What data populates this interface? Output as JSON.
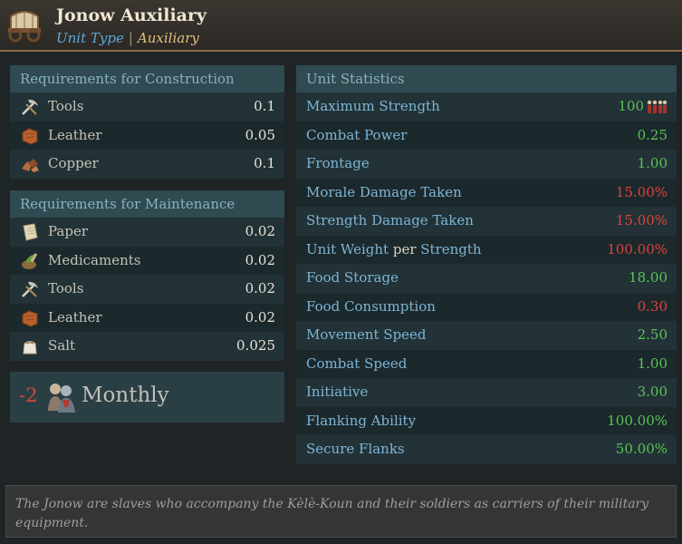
{
  "header": {
    "title": "Jonow Auxiliary",
    "type_key": "Unit Type",
    "separator": "|",
    "type_value": "Auxiliary"
  },
  "construction": {
    "heading": "Requirements for Construction",
    "items": [
      {
        "icon": "tools-icon",
        "label": "Tools",
        "value": "0.1"
      },
      {
        "icon": "leather-icon",
        "label": "Leather",
        "value": "0.05"
      },
      {
        "icon": "copper-icon",
        "label": "Copper",
        "value": "0.1"
      }
    ]
  },
  "maintenance": {
    "heading": "Requirements for Maintenance",
    "items": [
      {
        "icon": "paper-icon",
        "label": "Paper",
        "value": "0.02"
      },
      {
        "icon": "medicaments-icon",
        "label": "Medicaments",
        "value": "0.02"
      },
      {
        "icon": "tools-icon",
        "label": "Tools",
        "value": "0.02"
      },
      {
        "icon": "leather-icon",
        "label": "Leather",
        "value": "0.02"
      },
      {
        "icon": "salt-icon",
        "label": "Salt",
        "value": "0.025"
      }
    ]
  },
  "monthly": {
    "value": "-2",
    "icon": "population-icon",
    "label": "Monthly"
  },
  "stats": {
    "heading": "Unit Statistics",
    "items": [
      {
        "label": "Maximum Strength",
        "value": "100",
        "color": "green",
        "icon": "soldiers-icon"
      },
      {
        "label": "Combat Power",
        "value": "0.25",
        "color": "green"
      },
      {
        "label": "Frontage",
        "value": "1.00",
        "color": "green"
      },
      {
        "label": "Morale Damage Taken",
        "value": "15.00%",
        "color": "red"
      },
      {
        "label": "Strength Damage Taken",
        "value": "15.00%",
        "color": "red"
      },
      {
        "label_a": "Unit Weight",
        "label_per": "per",
        "label_b": "Strength",
        "value": "100.00%",
        "color": "red"
      },
      {
        "label": "Food Storage",
        "value": "18.00",
        "color": "green"
      },
      {
        "label": "Food Consumption",
        "value": "0.30",
        "color": "red"
      },
      {
        "label": "Movement Speed",
        "value": "2.50",
        "color": "green"
      },
      {
        "label": "Combat Speed",
        "value": "1.00",
        "color": "green"
      },
      {
        "label": "Initiative",
        "value": "3.00",
        "color": "green"
      },
      {
        "label": "Flanking Ability",
        "value": "100.00%",
        "color": "green"
      },
      {
        "label": "Secure Flanks",
        "value": "50.00%",
        "color": "green"
      }
    ]
  },
  "description": "The Jonow are slaves who accompany the Kèlè-Koun and their soldiers as carriers of their military equipment."
}
